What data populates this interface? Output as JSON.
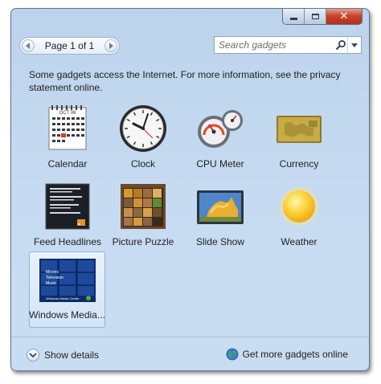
{
  "pager": {
    "label": "Page 1 of 1"
  },
  "search": {
    "placeholder": "Search gadgets"
  },
  "notice": "Some gadgets access the Internet.  For more information, see the privacy statement online.",
  "gadgets": [
    {
      "label": "Calendar"
    },
    {
      "label": "Clock"
    },
    {
      "label": "CPU Meter"
    },
    {
      "label": "Currency"
    },
    {
      "label": "Feed Headlines"
    },
    {
      "label": "Picture Puzzle"
    },
    {
      "label": "Slide Show"
    },
    {
      "label": "Weather"
    },
    {
      "label": "Windows Media..."
    }
  ],
  "calendar_thumb": {
    "month": "OCT 06",
    "rows": [
      "1 2 3 4 5 6 7",
      "8 9 10 11 12 13 14",
      "15 16 17 18 19 20 21",
      "22 23 24 25 26 27 28",
      "29 30 31"
    ]
  },
  "media_thumb": {
    "items": [
      "Movies",
      "Television",
      "Music"
    ],
    "caption": "Windows Media Center"
  },
  "footer": {
    "show_details": "Show details",
    "more_online": "Get more gadgets online"
  },
  "colors": {
    "window_bg": "#c6dbf1",
    "close_red": "#c8442b",
    "selected_tile": "#d3e4f6"
  }
}
